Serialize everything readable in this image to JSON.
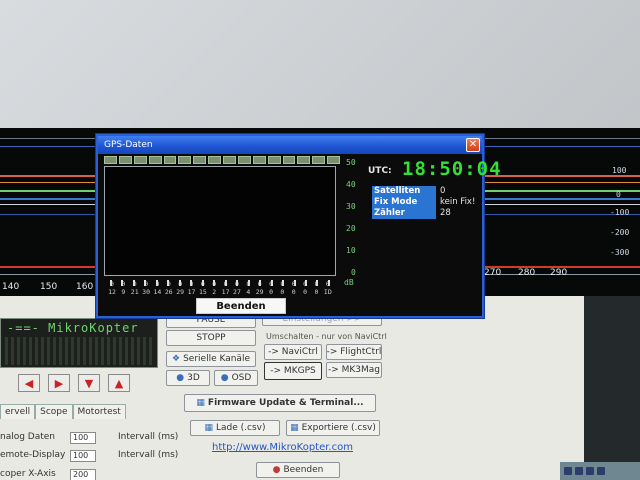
{
  "background_plot": {
    "x_labels": [
      "140",
      "150",
      "160",
      "270",
      "280",
      "290"
    ],
    "right_labels": [
      "100",
      "0",
      "-100",
      "-200",
      "-300"
    ]
  },
  "mikrokopter": {
    "display_title": "-==- MikroKopter"
  },
  "tabs": [
    "ervell",
    "Scope",
    "Motortest"
  ],
  "options": [
    {
      "label": "nalog Daten",
      "value": "100",
      "unit": "Intervall (ms)"
    },
    {
      "label": "emote-Display",
      "value": "100",
      "unit": "Intervall (ms)"
    },
    {
      "label": "coper X-Axis",
      "value": "200",
      "unit": ""
    }
  ],
  "buttons": {
    "pause": "PAUSE",
    "stop": "STOPP",
    "serial": "Serielle Kanäle",
    "view3d": "3D",
    "osd": "OSD",
    "hidden": "Einstellungen >>",
    "switch_label": "Umschalten - nur von NaviCtrl",
    "navictrl": "-> NaviCtrl",
    "flightctrl": "-> FlightCtrl",
    "mkgps": "-> MKGPS",
    "mk3mag": "-> MK3Mag",
    "firmware": "Firmware Update & Terminal...",
    "load": "Lade (.csv)",
    "export": "Exportiere (.csv)",
    "exit": "Beenden"
  },
  "link": "http://www.MikroKopter.com",
  "gps_dialog": {
    "title": "GPS-Daten",
    "db_labels": [
      "50",
      "40",
      "30",
      "20",
      "10",
      "0",
      "dB"
    ],
    "signal_values": [
      "0",
      "0",
      "0",
      "0",
      "0",
      "0",
      "0",
      "0",
      "0",
      "0",
      "0",
      "0",
      "0",
      "0",
      "0",
      "0",
      "0",
      "0",
      "0",
      "0"
    ],
    "satellite_ids": [
      "12",
      "9",
      "21",
      "30",
      "14",
      "26",
      "29",
      "17",
      "15",
      "2",
      "17",
      "27",
      "4",
      "29",
      "0",
      "0",
      "0",
      "0",
      "0",
      "ID"
    ],
    "utc_label": "UTC:",
    "utc_time": "18:50:04",
    "rows": [
      {
        "key": "Satelliten",
        "value": "0"
      },
      {
        "key": "Fix Mode",
        "value": "kein Fix!"
      },
      {
        "key": "Zähler",
        "value": "28"
      }
    ],
    "close_button": "Beenden"
  }
}
